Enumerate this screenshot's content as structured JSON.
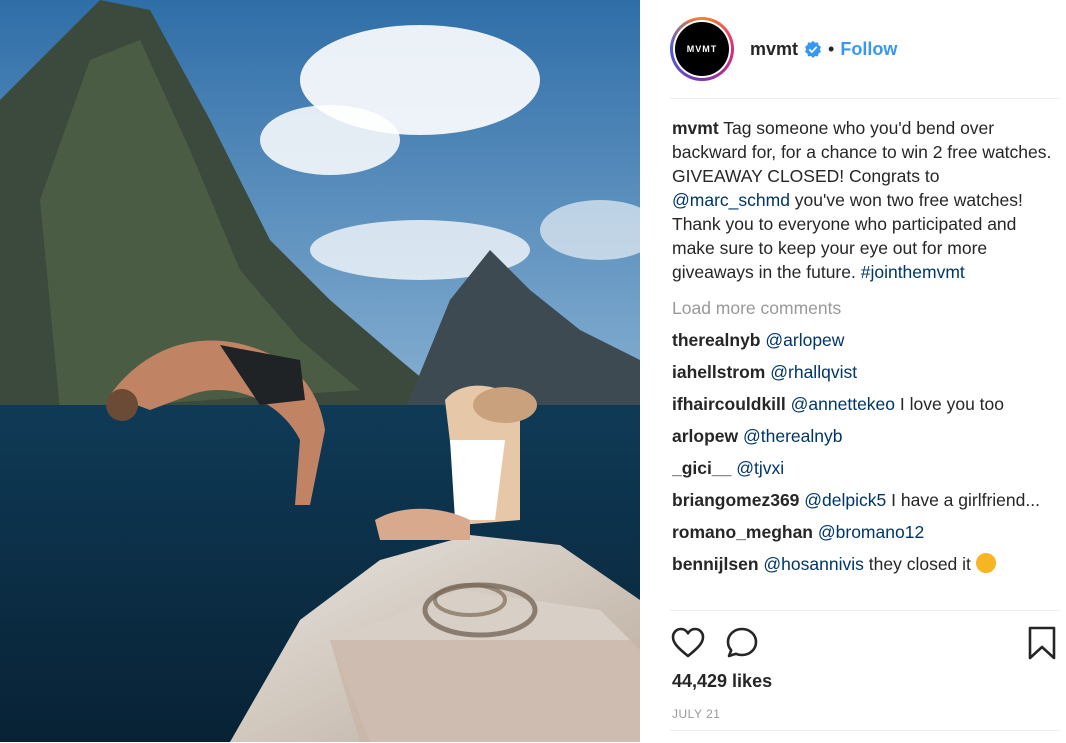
{
  "post": {
    "account": {
      "avatar_text": "MVMT",
      "username": "mvmt",
      "verified": true,
      "separator": "•",
      "follow_label": "Follow"
    },
    "caption": {
      "username": "mvmt",
      "text_1": " Tag someone who you'd bend over backward for, for a chance to win 2 free watches. GIVEAWAY CLOSED! Congrats to ",
      "mention": "@marc_schmd",
      "text_2": " you've won two free watches! Thank you to everyone who participated and make sure to keep your eye out for more giveaways in the future. ",
      "hashtag": "#jointhemvmt"
    },
    "load_more_label": "Load more comments",
    "comments": [
      {
        "user": "therealnyb",
        "mention": "@arlopew",
        "text": ""
      },
      {
        "user": "iahellstrom",
        "mention": "@rhallqvist",
        "text": ""
      },
      {
        "user": "ifhaircouldkill",
        "mention": "@annettekeo",
        "text": " I love you too"
      },
      {
        "user": "arlopew",
        "mention": "@therealnyb",
        "text": ""
      },
      {
        "user": "_gici__",
        "mention": "@tjvxi",
        "text": ""
      },
      {
        "user": "briangomez369",
        "mention": "@delpick5",
        "text": " I have a girlfriend..."
      },
      {
        "user": "romano_meghan",
        "mention": "@bromano12",
        "text": ""
      },
      {
        "user": "bennijlsen",
        "mention": "@hosannivis",
        "text": " they closed it "
      }
    ],
    "likes_label": "44,429 likes",
    "date_label": "JULY 21"
  },
  "icons": [
    "heart-icon",
    "comment-icon",
    "bookmark-icon",
    "verified-icon"
  ],
  "colors": {
    "accent": "#3897f0",
    "mention": "#003569",
    "muted": "#999999",
    "text": "#262626"
  }
}
